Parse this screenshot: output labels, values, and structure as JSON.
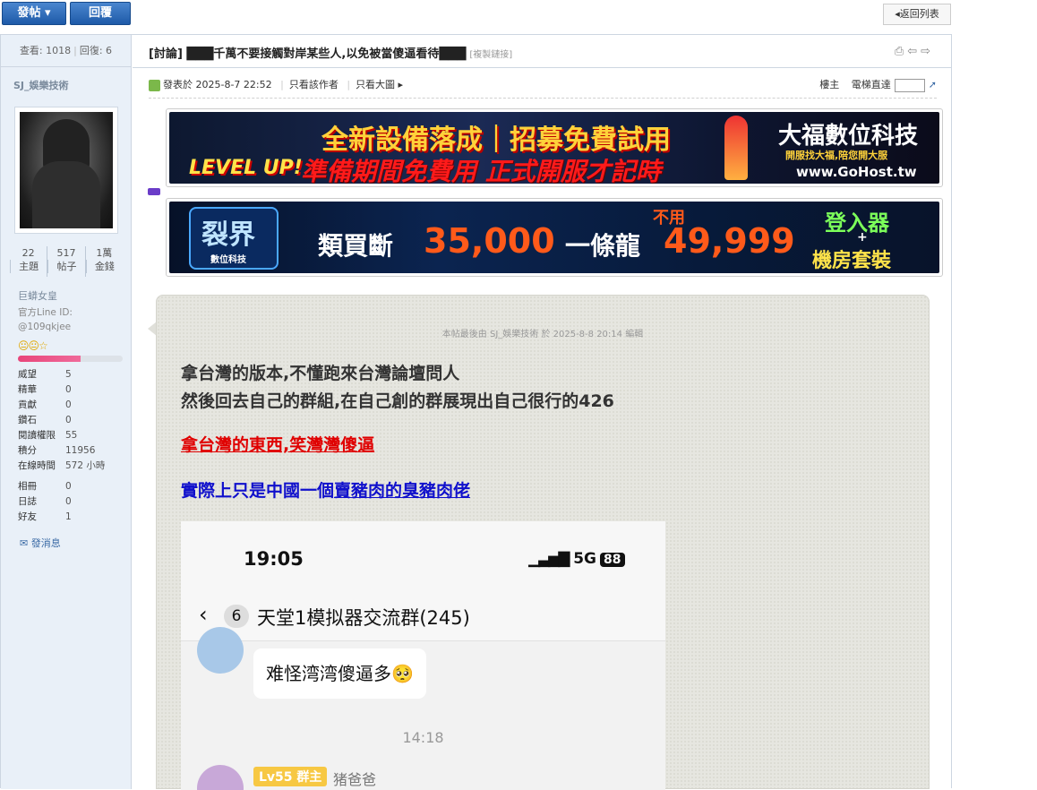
{
  "toolbar": {
    "post_label": "發帖 ▾",
    "reply_label": "回覆",
    "back_label": "◂返回列表"
  },
  "sidebar": {
    "stats": {
      "views_label": "查看: 1018",
      "replies_label": "回復: 6"
    },
    "username": "SJ_娛樂技術",
    "counts": [
      {
        "value": "22",
        "label": "主題"
      },
      {
        "value": "517",
        "label": "帖子"
      },
      {
        "value": "1萬",
        "label": "金錢"
      }
    ],
    "rank_title": "巨蟒女皇",
    "line_id_label": "官方Line ID:",
    "line_id": "@109qkjee",
    "rank_stars": "😐😐☆",
    "rank_progress": 0.6,
    "info": [
      {
        "k": "威望",
        "v": "5"
      },
      {
        "k": "精華",
        "v": "0"
      },
      {
        "k": "貢獻",
        "v": "0"
      },
      {
        "k": "鑽石",
        "v": "0"
      },
      {
        "k": "閱讀權限",
        "v": "55"
      },
      {
        "k": "積分",
        "v": "11956"
      },
      {
        "k": "在線時間",
        "v": "572 小時"
      }
    ],
    "info2": [
      {
        "k": "相冊",
        "v": "0"
      },
      {
        "k": "日誌",
        "v": "0"
      },
      {
        "k": "好友",
        "v": "1"
      }
    ],
    "send_message": "發消息"
  },
  "thread": {
    "title": "[討論] ███千萬不要接觸對岸某些人,以免被當傻逼看待███",
    "copy_link": "[複製鏈接]",
    "meta": {
      "posted": "發表於 2025-8-7 22:52",
      "only_author": "只看該作者",
      "big_image": "只看大圖 ▸",
      "floor": "樓主",
      "elevator": "電梯直達"
    }
  },
  "ads": {
    "ad1": {
      "headline": "全新設備落成｜招募免費試用",
      "level": "LEVEL UP!",
      "sub": "準備期間免費用 正式開服才記時",
      "brand": "大福數位科技",
      "brand_sub": "開服找大福,陪您開大服",
      "url": "www.GoHost.tw"
    },
    "ad2": {
      "logo": "裂界",
      "logo_sub": "數位科技",
      "text1": "類買斷",
      "price1": "35,000",
      "text2": "一條龍",
      "nouse": "不用",
      "price2": "49,999",
      "right1": "登入器",
      "right_plus": "+",
      "right2": "機房套裝"
    }
  },
  "post": {
    "edited": "本帖最後由 SJ_娛樂技術 於 2025-8-8 20:14 編輯",
    "line1": "拿台灣的版本,不懂跑來台灣論壇問人",
    "line2": "然後回去自己的群組,在自己創的群展現出自己很行的426",
    "line3": "拿台灣的東西,笑灣灣傻逼",
    "line4a": "實際上只是中國一個",
    "line4b": "賣豬肉的臭豬肉佬",
    "screenshot": {
      "time": "19:05",
      "signal": "5G",
      "battery": "88",
      "unread": "6",
      "group_name": "天堂1模拟器交流群(245)",
      "message": "难怪湾湾傻逼多🥺",
      "chat_time": "14:18",
      "level_badge": "Lv55 群主",
      "nickname": "猪爸爸"
    }
  }
}
